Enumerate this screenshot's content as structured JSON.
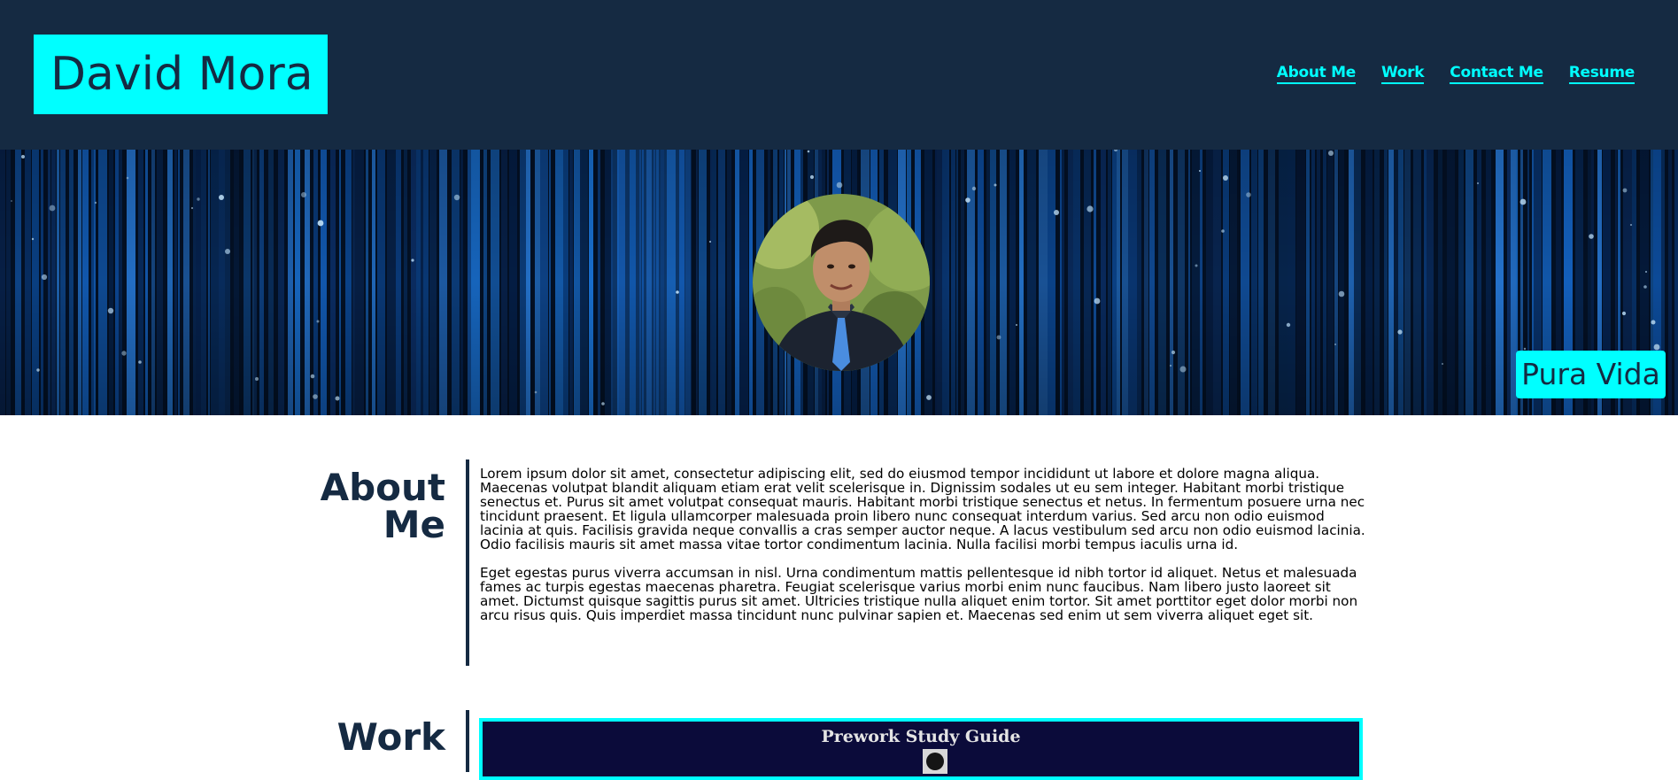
{
  "header": {
    "brand": "David Mora",
    "nav": [
      {
        "label": "About Me"
      },
      {
        "label": "Work"
      },
      {
        "label": "Contact Me"
      },
      {
        "label": "Resume"
      }
    ]
  },
  "hero": {
    "tagline": "Pura Vida"
  },
  "about": {
    "title_line1": "About",
    "title_line2": "Me",
    "paragraphs": [
      "Lorem ipsum dolor sit amet, consectetur adipiscing elit, sed do eiusmod tempor incididunt ut labore et dolore magna aliqua. Maecenas volutpat blandit aliquam etiam erat velit scelerisque in. Dignissim sodales ut eu sem integer. Habitant morbi tristique senectus et. Purus sit amet volutpat consequat mauris. Habitant morbi tristique senectus et netus. In fermentum posuere urna nec tincidunt praesent. Et ligula ullamcorper malesuada proin libero nunc consequat interdum varius. Sed arcu non odio euismod lacinia at quis. Facilisis gravida neque convallis a cras semper auctor neque. A lacus vestibulum sed arcu non odio euismod lacinia. Odio facilisis mauris sit amet massa vitae tortor condimentum lacinia. Nulla facilisi morbi tempus iaculis urna id.",
      "Eget egestas purus viverra accumsan in nisl. Urna condimentum mattis pellentesque id nibh tortor id aliquet. Netus et malesuada fames ac turpis egestas maecenas pharetra. Feugiat scelerisque varius morbi enim nunc faucibus. Nam libero justo laoreet sit amet. Dictumst quisque sagittis purus sit amet. Ultricies tristique nulla aliquet enim tortor. Sit amet porttitor eget dolor morbi non arcu risus quis. Quis imperdiet massa tincidunt nunc pulvinar sapien et. Maecenas sed enim ut sem viverra aliquet eget sit."
    ]
  },
  "work": {
    "title": "Work",
    "project_title": "Prework Study Guide"
  },
  "colors": {
    "navy": "#152a42",
    "accent": "#00ffff"
  },
  "icons": {
    "project_badge": "github-icon"
  }
}
